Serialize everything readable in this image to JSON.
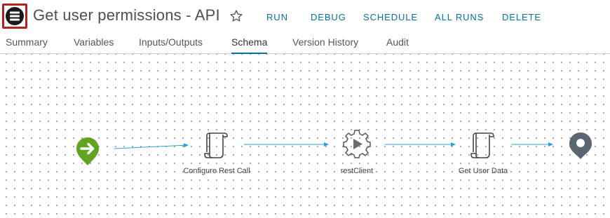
{
  "header": {
    "title": "Get user permissions - API",
    "actions": {
      "run": "RUN",
      "debug": "DEBUG",
      "schedule": "SCHEDULE",
      "all_runs": "ALL RUNS",
      "delete": "DELETE"
    }
  },
  "tabs": [
    {
      "label": "Summary"
    },
    {
      "label": "Variables"
    },
    {
      "label": "Inputs/Outputs"
    },
    {
      "label": "Schema",
      "active": true
    },
    {
      "label": "Version History"
    },
    {
      "label": "Audit"
    }
  ],
  "schema": {
    "nodes": [
      {
        "type": "start",
        "icon": "start-arrow-icon",
        "label": ""
      },
      {
        "type": "scriptable-task",
        "icon": "script-scroll-icon",
        "label": "Configure Rest Call"
      },
      {
        "type": "action",
        "icon": "gear-play-icon",
        "label": "restClient"
      },
      {
        "type": "scriptable-task",
        "icon": "script-scroll-icon",
        "label": "Get User Data"
      },
      {
        "type": "end",
        "icon": "end-pin-icon",
        "label": ""
      }
    ]
  },
  "colors": {
    "accent": "#0072a3",
    "logo_red": "#b4211e",
    "start_green": "#62a420",
    "end_gray": "#5b6670",
    "connector": "#2a9fd8"
  }
}
